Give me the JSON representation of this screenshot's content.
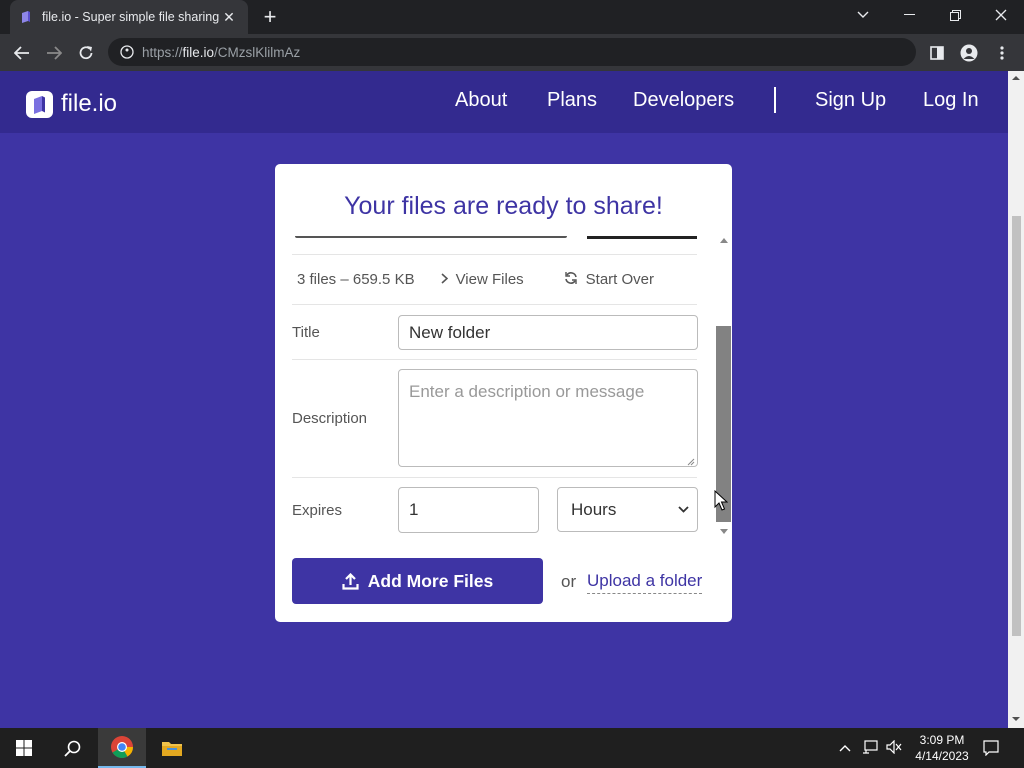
{
  "browser": {
    "tab_title": "file.io - Super simple file sharing",
    "url_prefix": "https://",
    "url_host": "file.io",
    "url_path": "/CMzslKlilmAz"
  },
  "site": {
    "logo_text": "file.io",
    "nav": [
      "About",
      "Plans",
      "Developers",
      "Sign Up",
      "Log In"
    ],
    "nav_separator": "|"
  },
  "card": {
    "title": "Your files are ready to share!",
    "summary": {
      "count": "3 files – 659.5 KB",
      "view_files": "View Files",
      "start_over": "Start Over"
    },
    "form": {
      "title_label": "Title",
      "title_value": "New folder",
      "description_label": "Description",
      "description_placeholder": "Enter a description or message",
      "expires_label": "Expires",
      "expires_value": "1",
      "expires_unit": "Hours"
    },
    "add_button": "Add More Files",
    "or_text": "or",
    "upload_folder": "Upload a folder"
  },
  "colors": {
    "brand": "#3e34a4",
    "header": "#332a8f"
  },
  "taskbar": {
    "time": "3:09 PM",
    "date": "4/14/2023"
  }
}
